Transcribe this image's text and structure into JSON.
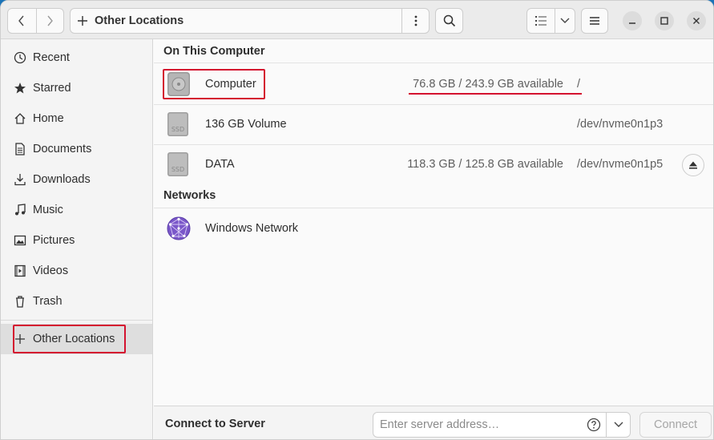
{
  "header": {
    "location_label": "Other Locations",
    "icons": {
      "back": "chevron-left-icon",
      "forward": "chevron-right-icon",
      "location": "plus-icon",
      "path_menu": "vertical-dots-icon",
      "search": "search-icon",
      "view": "list-view-icon",
      "view_dropdown": "chevron-down-icon",
      "main_menu": "hamburger-menu-icon",
      "minimize": "minimize-icon",
      "maximize": "maximize-icon",
      "close": "close-icon"
    }
  },
  "sidebar": {
    "items": [
      {
        "label": "Recent",
        "icon": "clock-icon"
      },
      {
        "label": "Starred",
        "icon": "star-icon"
      },
      {
        "label": "Home",
        "icon": "home-icon"
      },
      {
        "label": "Documents",
        "icon": "document-icon"
      },
      {
        "label": "Downloads",
        "icon": "download-icon"
      },
      {
        "label": "Music",
        "icon": "music-icon"
      },
      {
        "label": "Pictures",
        "icon": "picture-icon"
      },
      {
        "label": "Videos",
        "icon": "video-icon"
      },
      {
        "label": "Trash",
        "icon": "trash-icon"
      }
    ],
    "other_locations": {
      "label": "Other Locations",
      "icon": "plus-icon",
      "active": true
    }
  },
  "main": {
    "on_this_computer": {
      "title": "On This Computer",
      "rows": [
        {
          "name": "Computer",
          "capacity": "76.8 GB / 243.9 GB available",
          "path": "/",
          "icon": "hard-disk-icon"
        },
        {
          "name": "136 GB Volume",
          "capacity": "",
          "path": "/dev/nvme0n1p3",
          "icon": "ssd-drive-icon",
          "icon_text": "SSD"
        },
        {
          "name": "DATA",
          "capacity": "118.3 GB / 125.8 GB available",
          "path": "/dev/nvme0n1p5",
          "icon": "ssd-drive-icon",
          "icon_text": "SSD",
          "eject_icon": "eject-icon"
        }
      ]
    },
    "networks": {
      "title": "Networks",
      "rows": [
        {
          "name": "Windows Network",
          "icon": "network-globe-icon"
        }
      ]
    }
  },
  "bottom": {
    "connect_label": "Connect to Server",
    "server_placeholder": "Enter server address…",
    "connect_button": "Connect",
    "help_icon": "help-circle-icon",
    "dropdown_icon": "chevron-down-icon"
  },
  "colors": {
    "annotation_red": "#d4122f",
    "network_icon": "#7a57c9"
  }
}
